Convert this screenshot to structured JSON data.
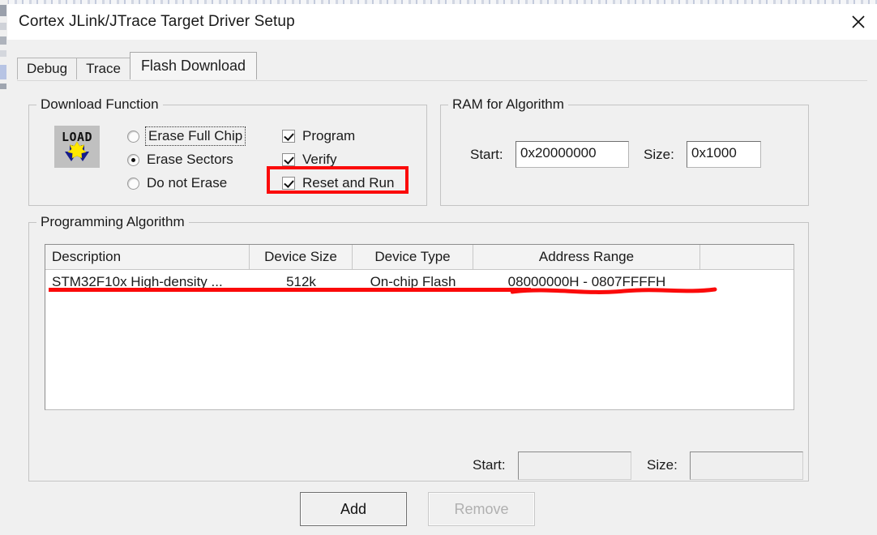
{
  "window": {
    "title": "Cortex JLink/JTrace Target Driver Setup",
    "close_icon": "close-icon"
  },
  "tabs": [
    {
      "label": "Debug",
      "active": false
    },
    {
      "label": "Trace",
      "active": false
    },
    {
      "label": "Flash Download",
      "active": true
    }
  ],
  "download_function": {
    "legend": "Download Function",
    "icon": "load-icon",
    "radios": [
      {
        "label": "Erase Full Chip",
        "checked": false,
        "focused": true
      },
      {
        "label": "Erase Sectors",
        "checked": true,
        "focused": false
      },
      {
        "label": "Do not Erase",
        "checked": false,
        "focused": false
      }
    ],
    "checkboxes": [
      {
        "label": "Program",
        "checked": true,
        "highlighted": false
      },
      {
        "label": "Verify",
        "checked": true,
        "highlighted": false
      },
      {
        "label": "Reset and Run",
        "checked": true,
        "highlighted": true
      }
    ]
  },
  "ram_for_algorithm": {
    "legend": "RAM for Algorithm",
    "start_label": "Start:",
    "start_value": "0x20000000",
    "size_label": "Size:",
    "size_value": "0x1000"
  },
  "programming_algorithm": {
    "legend": "Programming Algorithm",
    "columns": [
      "Description",
      "Device Size",
      "Device Type",
      "Address Range",
      ""
    ],
    "rows": [
      {
        "description": "STM32F10x High-density ...",
        "device_size": "512k",
        "device_type": "On-chip Flash",
        "address_range": "08000000H - 0807FFFFH"
      }
    ],
    "start_label": "Start:",
    "start_value": "",
    "size_label": "Size:",
    "size_value": ""
  },
  "buttons": {
    "add": "Add",
    "remove": "Remove"
  },
  "annotations": {
    "accent_color": "#fb0a0a",
    "box_target": "Reset and Run",
    "underline_targets": [
      "STM32F10x High-density ... 512k On-chip Flash",
      "08000000H - 0807FFFFH"
    ]
  }
}
